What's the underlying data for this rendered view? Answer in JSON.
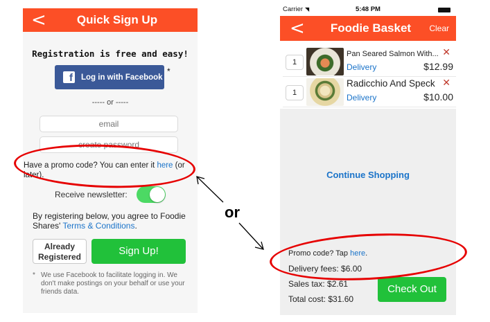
{
  "left_screen": {
    "nav": {
      "back_glyph": "<",
      "title": "Quick Sign Up",
      "back_icon": "chevron-left-icon"
    },
    "registration_title": "Registration is free and easy!",
    "facebook_button": {
      "icon": "facebook-icon",
      "logo_glyph": "f",
      "label": "Log in with Facebook",
      "asterisk": "*"
    },
    "divider": "----- or -----",
    "email_field": {
      "placeholder": "email",
      "value": ""
    },
    "password_field": {
      "placeholder": "create password",
      "value": ""
    },
    "promo": {
      "text_before": "Have a promo code? You can enter it ",
      "link": "here",
      "text_after": " (or later)."
    },
    "newsletter": {
      "label": "Receive newsletter:",
      "enabled": true
    },
    "terms": {
      "text": "By registering below, you agree to Foodie Shares' ",
      "link": "Terms & Conditions",
      "end": "."
    },
    "already_button": {
      "line1": "Already",
      "line2": "Registered"
    },
    "signup_button": {
      "label": "Sign Up!"
    },
    "facebook_note": {
      "bullet": "*",
      "text": "We use Facebook to facilitate logging in. We don't make postings on your behalf or use your friends data."
    }
  },
  "right_screen": {
    "status_bar": {
      "carrier": "Carrier",
      "wifi_icon": "wifi-icon",
      "time": "5:48 PM",
      "battery_icon": "battery-icon"
    },
    "nav": {
      "back_glyph": "<",
      "title": "Foodie Basket",
      "clear_label": "Clear"
    },
    "items": [
      {
        "quantity": "1",
        "name": "Pan Seared Salmon With...",
        "delivery": "Delivery",
        "price": "$12.99",
        "remove_glyph": "✕"
      },
      {
        "quantity": "1",
        "name": "Radicchio And Speck",
        "delivery": "Delivery",
        "price": "$10.00",
        "remove_glyph": "✕"
      }
    ],
    "continue_shopping": "Continue Shopping",
    "promo": {
      "text": "Promo code? Tap ",
      "link": "here",
      "end": "."
    },
    "delivery_fees": "Delivery fees: $6.00",
    "sales_tax": "Sales tax: $2.61",
    "total_cost": "Total cost: $31.60",
    "checkout_button": "Check Out"
  },
  "annotation": {
    "or_label": "or",
    "highlight_color": "#e60000"
  },
  "colors": {
    "nav_orange": "#fc4f26",
    "button_green": "#21c13a",
    "facebook_blue": "#3b5998",
    "link_blue": "#1a73c9",
    "toggle_green": "#4cd964"
  }
}
